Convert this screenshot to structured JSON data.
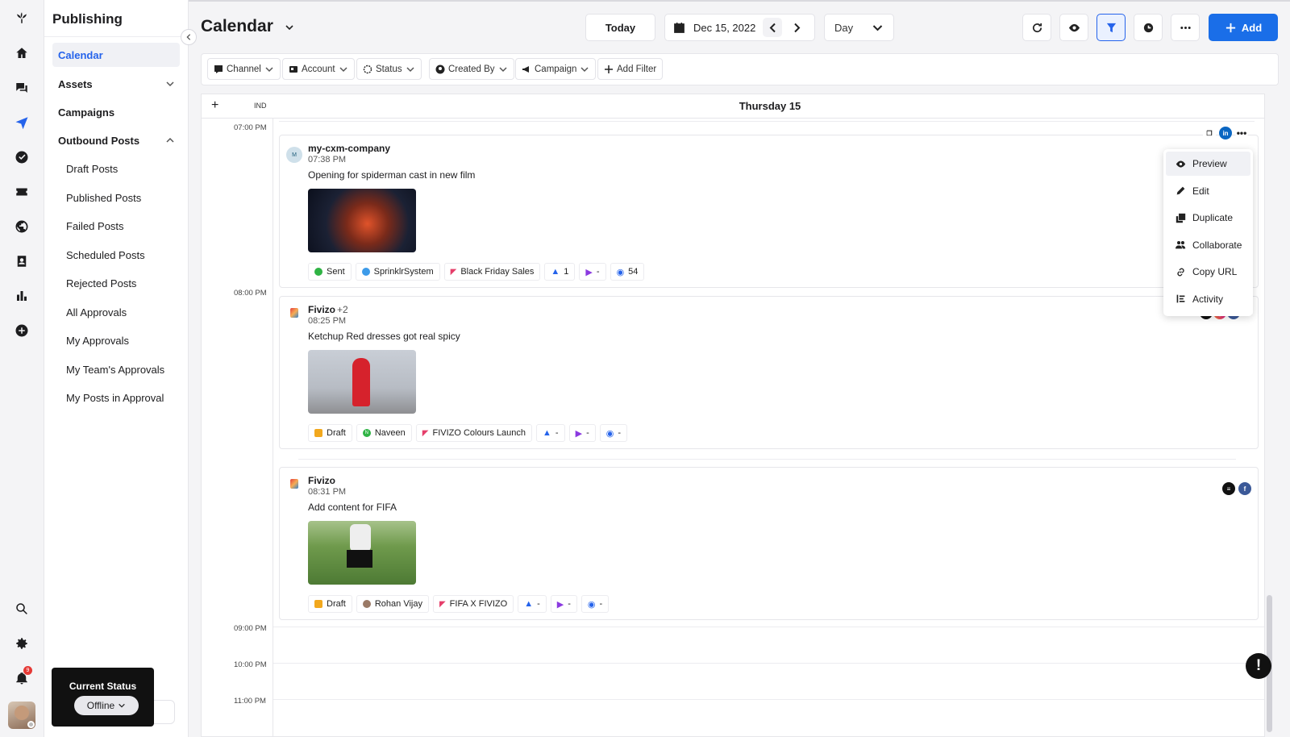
{
  "app": {
    "section_title": "Publishing",
    "status_label": "Current Status",
    "status_value": "Offline",
    "notification_count": "9"
  },
  "sidebar": {
    "items": [
      {
        "label": "Calendar"
      },
      {
        "label": "Assets"
      },
      {
        "label": "Campaigns"
      },
      {
        "label": "Outbound Posts"
      },
      {
        "label": "Draft Posts"
      },
      {
        "label": "Published Posts"
      },
      {
        "label": "Failed Posts"
      },
      {
        "label": "Scheduled Posts"
      },
      {
        "label": "Rejected Posts"
      },
      {
        "label": "All Approvals"
      },
      {
        "label": "My Approvals"
      },
      {
        "label": "My Team's Approvals"
      },
      {
        "label": "My Posts in Approval"
      }
    ]
  },
  "header": {
    "title": "Calendar",
    "today": "Today",
    "date": "Dec 15, 2022",
    "view": "Day",
    "add": "Add"
  },
  "filters": [
    "Channel",
    "Account",
    "Status",
    "Created By",
    "Campaign",
    "Add Filter"
  ],
  "calendar": {
    "timezone": "IND",
    "day_label": "Thursday 15",
    "times": [
      "07:00 PM",
      "08:00 PM",
      "09:00 PM",
      "10:00 PM",
      "11:00 PM"
    ]
  },
  "posts": [
    {
      "avatar": "M",
      "name": "my-cxm-company",
      "extra": "",
      "time": "07:38 PM",
      "text": "Opening for spiderman cast in new film",
      "status": "Sent",
      "user": "SprinklrSystem",
      "campaign": "Black Friday Sales",
      "likes": "1",
      "shares": "-",
      "views": "54"
    },
    {
      "avatar": "",
      "name": "Fivizo",
      "extra": "+2",
      "time": "08:25 PM",
      "text": "Ketchup Red dresses got real spicy",
      "status": "Draft",
      "user_initial": "N",
      "user": "Naveen",
      "campaign": "FIVIZO Colours Launch",
      "likes": "-",
      "shares": "-",
      "views": "-",
      "channel_more": "+1"
    },
    {
      "avatar": "",
      "name": "Fivizo",
      "extra": "",
      "time": "08:31 PM",
      "text": "Add content for FIFA",
      "status": "Draft",
      "user": "Rohan Vijay",
      "campaign": "FIFA X FIVIZO",
      "likes": "-",
      "shares": "-",
      "views": "-"
    }
  ],
  "menu": {
    "items": [
      "Preview",
      "Edit",
      "Duplicate",
      "Collaborate",
      "Copy URL",
      "Activity"
    ]
  },
  "colors": {
    "accent": "#1a6ee8",
    "sent": "#2fb344",
    "draft": "#f2a81d"
  }
}
